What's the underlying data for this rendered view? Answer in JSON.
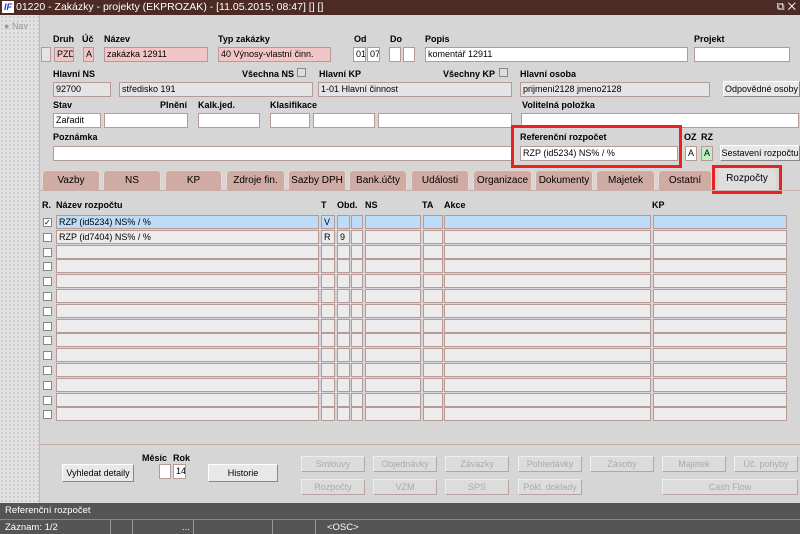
{
  "window": {
    "title": "01220 - Zakázky - projekty (EKPROZAK) - [11.05.2015; 08:47] [] []",
    "logo": "IF",
    "controls": "⧉ ✕"
  },
  "nav": {
    "label": "Nav"
  },
  "header": {
    "labels": {
      "druh": "Druh",
      "uc": "Úč",
      "nazev": "Název",
      "typ": "Typ zakázky",
      "od": "Od",
      "do": "Do",
      "popis": "Popis",
      "projekt": "Projekt",
      "hlavni_ns": "Hlavní NS",
      "vsechna_ns": "Všechna NS",
      "hlavni_kp": "Hlavní KP",
      "vsechny_kp": "Všechny KP",
      "hlavni_osoba": "Hlavní osoba",
      "stav": "Stav",
      "plneni": "Plnění",
      "kalk": "Kalk.jed.",
      "klasifikace": "Klasifikace",
      "volitelna": "Volitelná položka",
      "poznamka": "Poznámka",
      "ref": "Referenční rozpočet",
      "oz": "OZ",
      "rz": "RZ"
    },
    "values": {
      "druh": "PZD",
      "uc": "A",
      "nazev": "zakázka 12911",
      "typ": "40 Výnosy-vlastní činn.",
      "od1": "01",
      "od2": "07",
      "popis": "komentář 12911",
      "hlavni_ns": "92700",
      "ns_nazev": "středisko 191",
      "hlavni_kp": "1-01 Hlavní činnost",
      "hlavni_osoba": "prijmeni2128 jmeno2128",
      "stav": "Zařadit",
      "ref": "RZP (id5234) NS% / %",
      "oz": "A",
      "rz": "A"
    },
    "buttons": {
      "odpovedne": "Odpovědné osoby",
      "sestaveni": "Sestavení rozpočtu"
    }
  },
  "tabs": [
    "Vazby",
    "NS",
    "KP",
    "Zdroje fin.",
    "Sazby DPH",
    "Bank.účty",
    "Události",
    "Organizace",
    "Dokumenty",
    "Majetek",
    "Ostatní",
    "Rozpočty"
  ],
  "grid": {
    "headers": {
      "r": "R.",
      "nazev": "Název rozpočtu",
      "t": "T",
      "obd": "Obd.",
      "ns": "NS",
      "ta": "TA",
      "akce": "Akce",
      "kp": "KP"
    },
    "rows": [
      {
        "checked": true,
        "nazev": "RZP (id5234) NS% / %",
        "t": "V",
        "obd": ""
      },
      {
        "checked": false,
        "nazev": "RZP (id7404) NS% / %",
        "t": "R",
        "obd": "9"
      },
      {},
      {},
      {},
      {},
      {},
      {},
      {},
      {},
      {},
      {},
      {},
      {}
    ]
  },
  "bottom": {
    "vyhledat": "Vyhledat detaily",
    "mesic": "Měsíc",
    "rok": "Rok",
    "rok_value": "14",
    "historie": "Historie",
    "row1": [
      "Smlouvy",
      "Objednávky",
      "Závazky",
      "Pohledávky",
      "Zásoby",
      "Majetek",
      "Úč. pohyby"
    ],
    "row2": [
      "Rozpočty",
      "VZM",
      "SPS",
      "Pokl. doklady",
      "Cash Flow"
    ]
  },
  "status": {
    "line1": "Referenční rozpočet",
    "record": "Záznam: 1/2",
    "dots": "...",
    "mode": "<OSC>"
  }
}
